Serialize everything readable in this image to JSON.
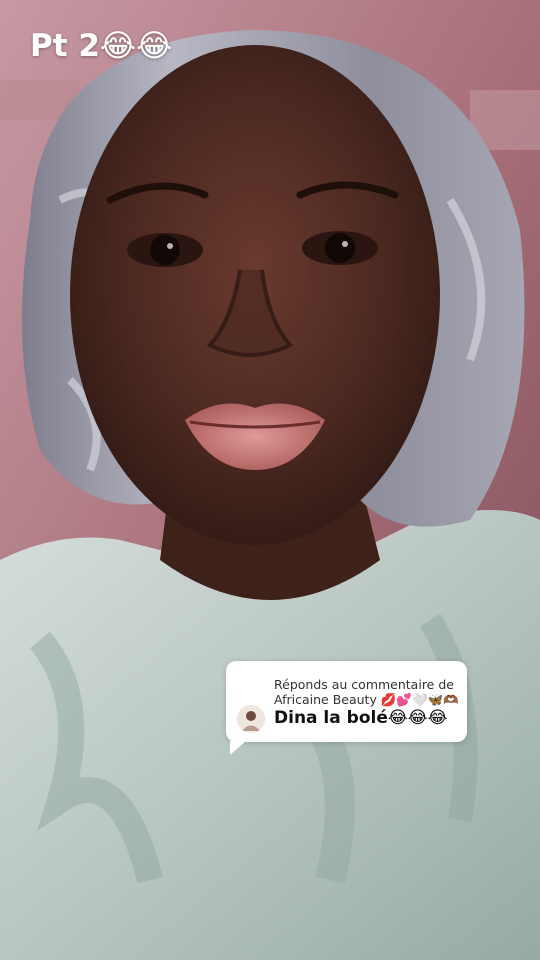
{
  "caption": {
    "text": "Pt 2😂😂"
  },
  "reply": {
    "line1": "Réponds au commentaire de",
    "line2": "Africaine Beauty 💋💕🤍🦋🫶🏾",
    "comment": "Dina la bolé😂😂😂"
  },
  "icons": {
    "reply_avatar": "user-avatar"
  },
  "colors": {
    "card_bg": "#ffffff",
    "caption_text": "#ffffff",
    "bonnet": "#9a9aa6",
    "shirt": "#c9d3cf",
    "skin": "#4a2a22"
  }
}
